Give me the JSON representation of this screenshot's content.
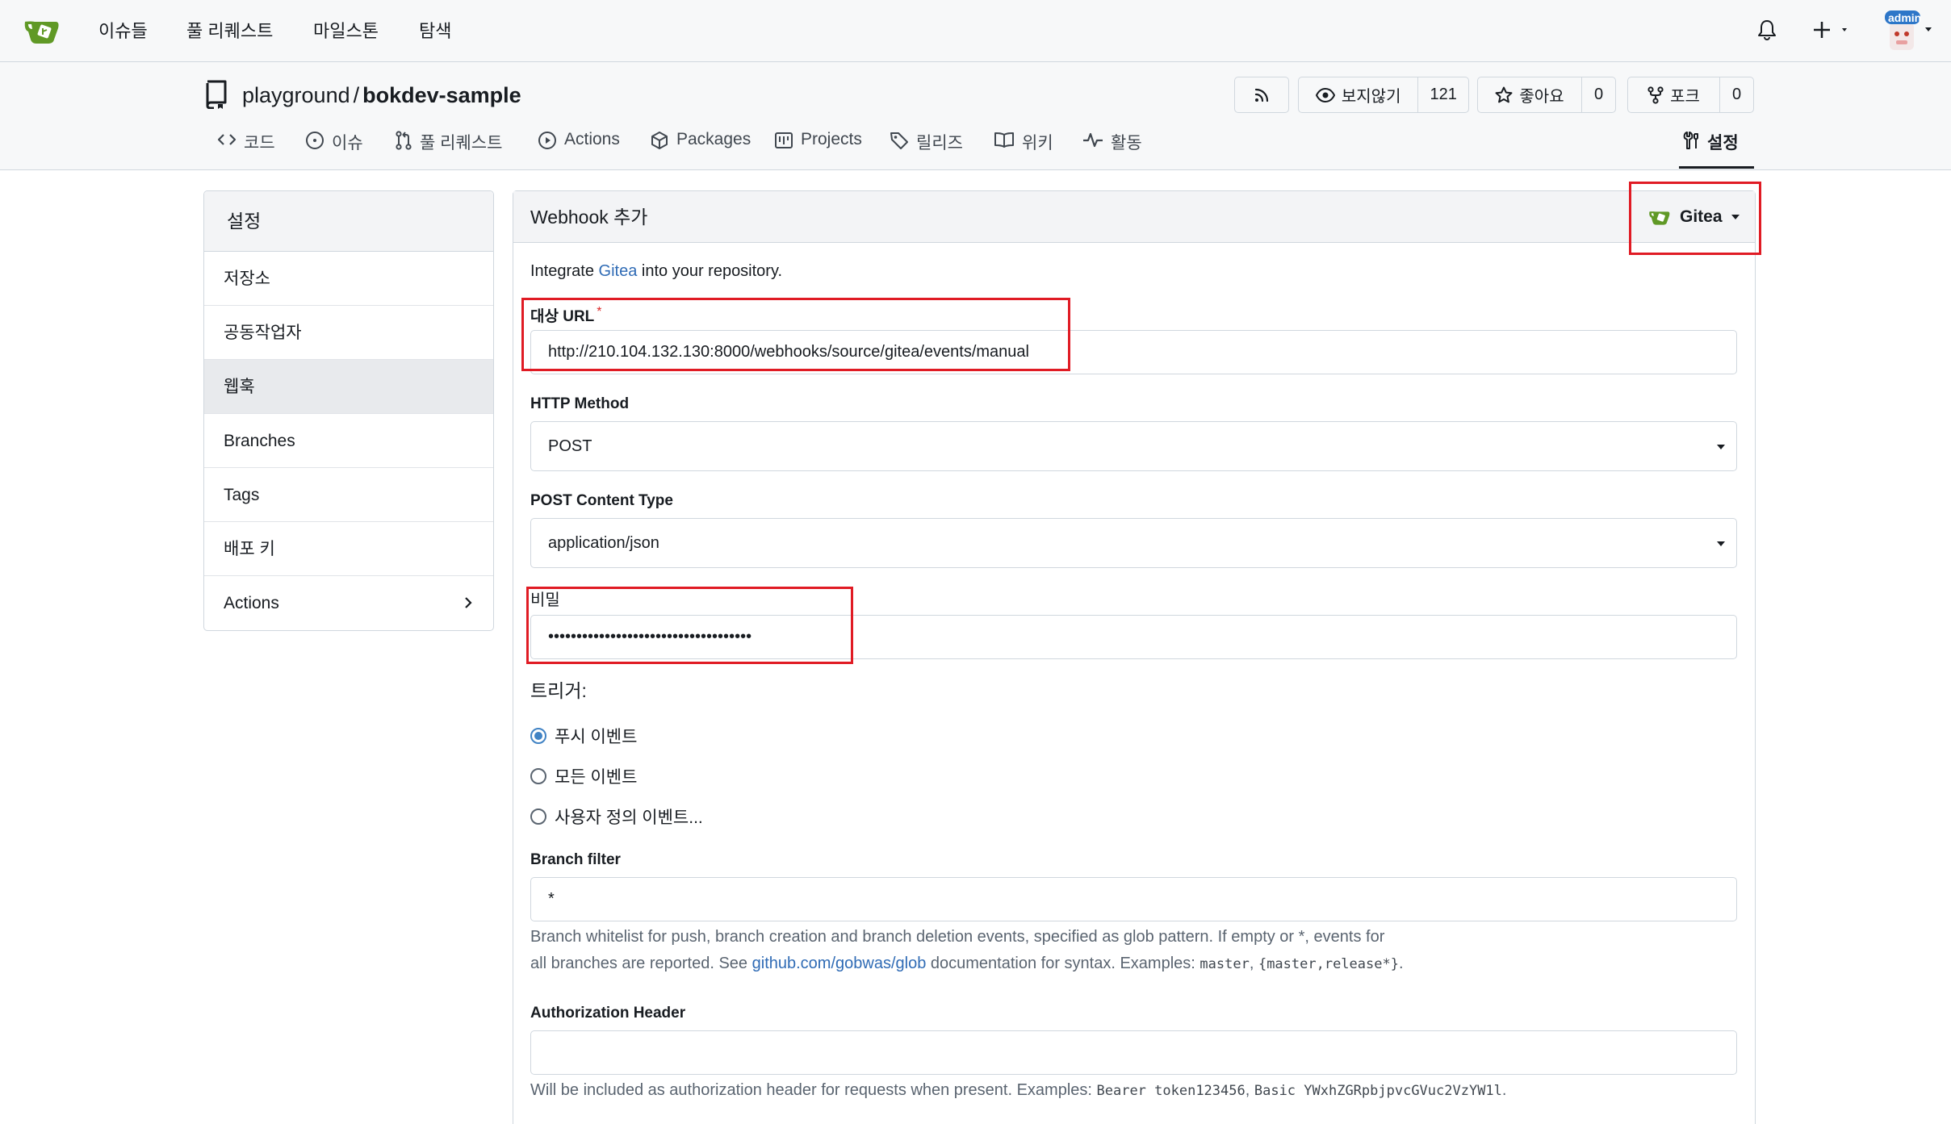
{
  "navbar": {
    "items": [
      "이슈들",
      "풀 리퀘스트",
      "마일스톤",
      "탐색"
    ],
    "avatar_badge": "admin"
  },
  "repo": {
    "owner": "playground",
    "separator": "/",
    "name": "bokdev-sample",
    "watch_label": "보지않기",
    "watch_count": "121",
    "star_label": "좋아요",
    "star_count": "0",
    "fork_label": "포크",
    "fork_count": "0",
    "tabs": [
      "코드",
      "이슈",
      "풀 리퀘스트",
      "Actions",
      "Packages",
      "Projects",
      "릴리즈",
      "위키",
      "활동",
      "설정"
    ]
  },
  "sidebar": {
    "header": "설정",
    "items": [
      "저장소",
      "공동작업자",
      "웹훅",
      "Branches",
      "Tags",
      "배포 키",
      "Actions"
    ]
  },
  "webhook": {
    "title": "Webhook 추가",
    "type_label": "Gitea",
    "intro_prefix": "Integrate",
    "intro_link": "Gitea",
    "intro_suffix": "into your repository.",
    "url_label": "대상 URL",
    "url_required": "*",
    "url_value": "http://210.104.132.130:8000/webhooks/source/gitea/events/manual",
    "method_label": "HTTP Method",
    "method_value": "POST",
    "content_type_label": "POST Content Type",
    "content_type_value": "application/json",
    "secret_label": "비밀",
    "secret_value": "••••••••••••••••••••••••••••••••••••",
    "trigger_label": "트리거:",
    "trigger_options": [
      "푸시 이벤트",
      "모든 이벤트",
      "사용자 정의 이벤트..."
    ],
    "trigger_selected": "푸시 이벤트",
    "branch_filter_label": "Branch filter",
    "branch_filter_value": "*",
    "branch_help_1": "Branch whitelist for push, branch creation and branch deletion events, specified as glob pattern. If empty or *, events for",
    "branch_help_2a": "all branches are reported. See",
    "branch_help_link": "github.com/gobwas/glob",
    "branch_help_2b": "documentation for syntax. Examples:",
    "branch_help_code1": "master",
    "branch_help_code2": "{master,release*}",
    "branch_help_comma": ",",
    "branch_help_end": ".",
    "auth_label": "Authorization Header",
    "auth_help_prefix": "Will be included as authorization header for requests when present. Examples:",
    "auth_help_code1": "Bearer token123456",
    "auth_help_comma": ",",
    "auth_help_code2": "Basic YWxhZGRpbjpvcGVuc2VzYW1l",
    "auth_help_end": "."
  },
  "colors": {
    "accent": "#4183c4",
    "link": "#2f6bb5",
    "brand_green": "#609926",
    "highlight": "#e01b24"
  }
}
